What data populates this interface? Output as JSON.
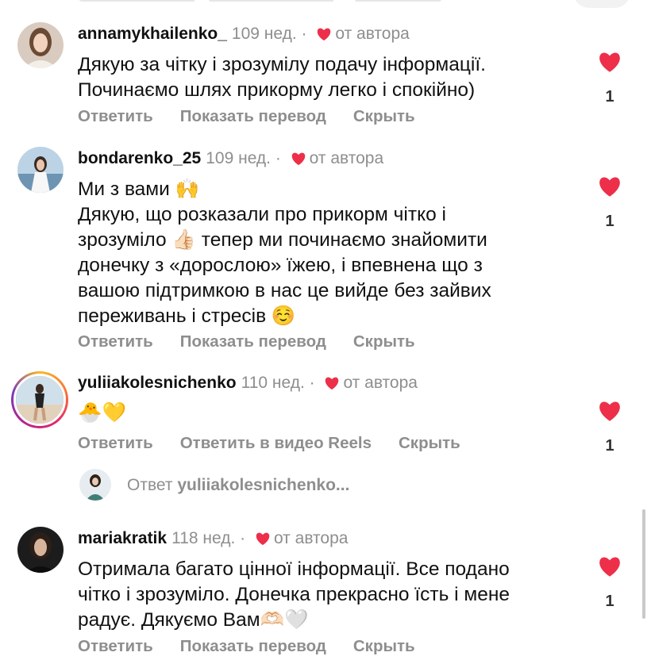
{
  "comments": [
    {
      "username": "annamykhailenko_",
      "time": "109 нед.",
      "author_label": "от автора",
      "text": "Дякую за чітку і зрозумілу подачу інформації.\nПочинаємо шлях прикорму легко і спокійно)",
      "actions": [
        "Ответить",
        "Показать перевод",
        "Скрыть"
      ],
      "likes": "1"
    },
    {
      "username": "bondarenko_25",
      "time": "109 нед.",
      "author_label": "от автора",
      "text": "Ми з вами 🙌\nДякую, що розказали про прикорм чітко і\nзрозуміло 👍🏻 тепер ми починаємо знайомити\nдонечку з «дорослою» їжею, і впевнена що з\nвашою підтримкою в нас це вийде без зайвих\nпереживань і стресів ☺️",
      "actions": [
        "Ответить",
        "Показать перевод",
        "Скрыть"
      ],
      "likes": "1"
    },
    {
      "username": "yuliiakolesnichenko",
      "time": "110 нед.",
      "author_label": "от автора",
      "text": "🐣💛",
      "actions": [
        "Ответить",
        "Ответить в видео Reels",
        "Скрыть"
      ],
      "likes": "1",
      "reply_thread": {
        "prefix": "Ответ",
        "name": "yuliiakolesnichenko..."
      }
    },
    {
      "username": "mariakratik",
      "time": "118 нед.",
      "author_label": "от автора",
      "text": "Отримала багато цінної інформації. Все подано\nчітко і зрозуміло. Донечка прекрасно їсть і мене\nрадує. Дякуємо Вам🫶🏻🤍",
      "actions": [
        "Ответить",
        "Показать перевод",
        "Скрыть"
      ],
      "likes": "1"
    }
  ],
  "colors": {
    "heart": "#ed2f4a",
    "muted": "#8e8e8e",
    "text": "#111111"
  },
  "icons": {
    "like": "heart-icon",
    "author_like": "heart-mini-icon"
  }
}
